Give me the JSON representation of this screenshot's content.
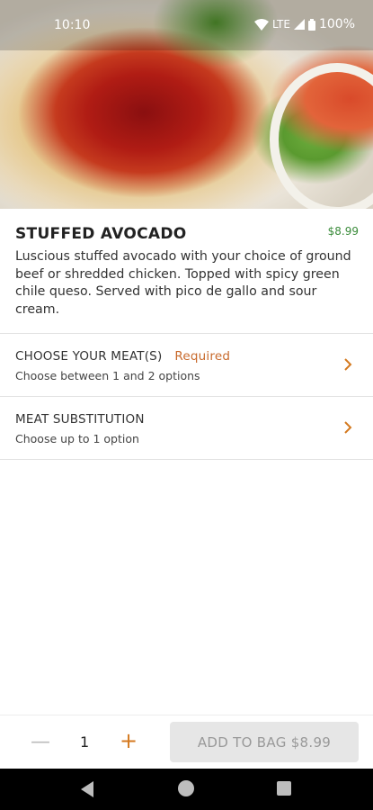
{
  "status_bar": {
    "time": "10:10",
    "network": "LTE",
    "battery": "100%"
  },
  "hero": {
    "icon": "food-photo"
  },
  "item": {
    "title": "STUFFED AVOCADO",
    "price": "$8.99",
    "description": "Luscious stuffed avocado with your choice of ground\nbeef or shredded chicken. Topped with spicy green chile queso. Served with pico de gallo and sour cream."
  },
  "options": [
    {
      "title": "CHOOSE YOUR MEAT(S)",
      "badge": "Required",
      "subtitle": "Choose between 1 and 2 options"
    },
    {
      "title": "MEAT SUBSTITUTION",
      "badge": "",
      "subtitle": "Choose up to 1 option"
    }
  ],
  "footer": {
    "minus": "—",
    "quantity": "1",
    "plus": "+",
    "add_button": "ADD TO BAG $8.99"
  },
  "colors": {
    "accent": "#d4791f",
    "price_green": "#3a8b3a",
    "required": "#c86a2c"
  }
}
